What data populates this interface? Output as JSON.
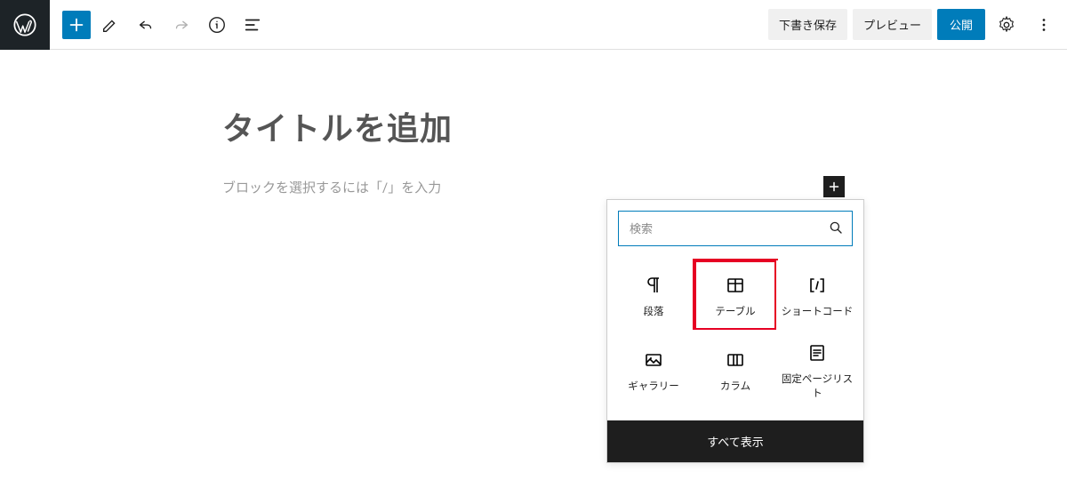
{
  "toolbar": {
    "save_draft": "下書き保存",
    "preview": "プレビュー",
    "publish": "公開"
  },
  "editor": {
    "title_placeholder": "タイトルを追加",
    "content_placeholder": "ブロックを選択するには「/」を入力"
  },
  "inserter": {
    "search_placeholder": "検索",
    "blocks": [
      {
        "label": "段落",
        "icon": "paragraph"
      },
      {
        "label": "テーブル",
        "icon": "table",
        "highlight": true
      },
      {
        "label": "ショートコード",
        "icon": "shortcode"
      },
      {
        "label": "ギャラリー",
        "icon": "gallery"
      },
      {
        "label": "カラム",
        "icon": "columns"
      },
      {
        "label": "固定ページリスト",
        "icon": "page-list"
      }
    ],
    "footer": "すべて表示"
  }
}
